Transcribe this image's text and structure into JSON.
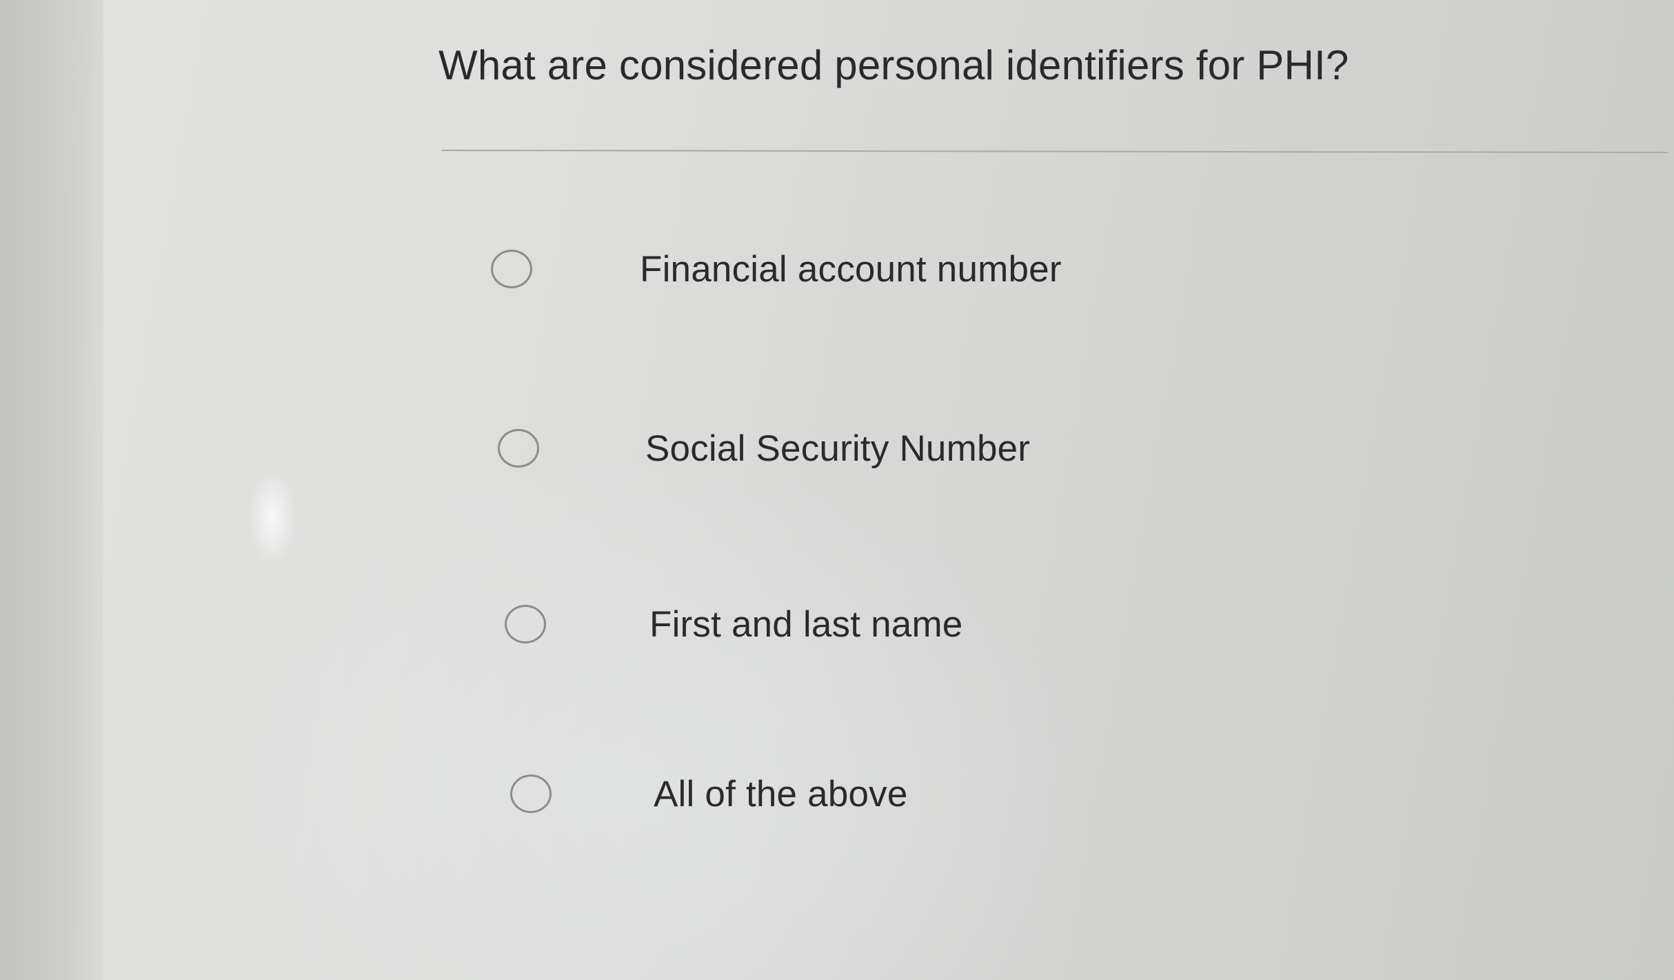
{
  "question": {
    "title": "What are considered personal identifiers for PHI?"
  },
  "options": [
    {
      "label": "Financial account number",
      "selected": false
    },
    {
      "label": "Social Security Number",
      "selected": false
    },
    {
      "label": "First and last name",
      "selected": false
    },
    {
      "label": "All of the above",
      "selected": false
    }
  ],
  "colors": {
    "text": "#2a2a2a",
    "radio_border": "#8b8c8a",
    "divider": "#a9aaa8",
    "background": "#d4d5d3"
  }
}
